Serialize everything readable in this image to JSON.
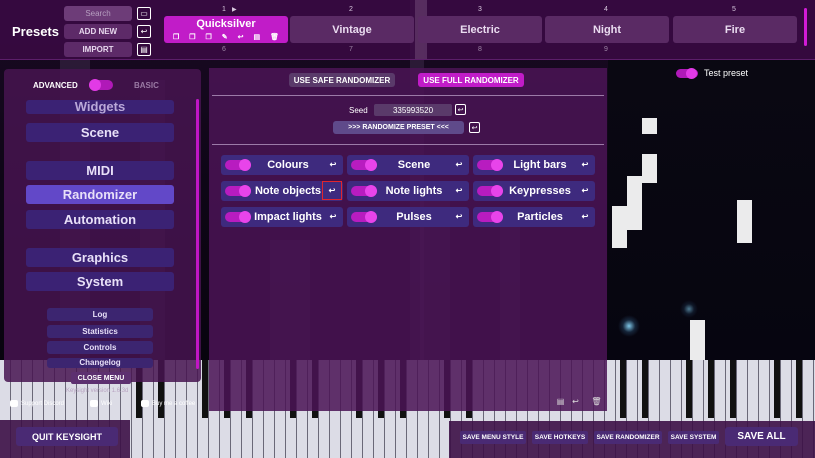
{
  "colors": {
    "accent": "#c11cc8",
    "panel": "#4b1455",
    "button": "#3e2a7e",
    "active_nav": "#6248c8",
    "highlight_outline": "#e0252e"
  },
  "presets": {
    "title": "Presets",
    "search_placeholder": "Search",
    "add_new": "ADD NEW",
    "import": "IMPORT",
    "slots": [
      {
        "number": "1",
        "name": "Quicksilver",
        "active": true
      },
      {
        "number": "2",
        "name": "Vintage",
        "active": false
      },
      {
        "number": "3",
        "name": "Electric",
        "active": false
      },
      {
        "number": "4",
        "name": "Night",
        "active": false
      },
      {
        "number": "5",
        "name": "Fire",
        "active": false
      }
    ],
    "next_row_numbers": [
      "6",
      "7",
      "8",
      "9"
    ]
  },
  "sidebar": {
    "mode_advanced": "ADVANCED",
    "mode_basic": "BASIC",
    "nav": [
      {
        "label": "Widgets"
      },
      {
        "label": "Scene"
      },
      {
        "label": "MIDI"
      },
      {
        "label": "Randomizer",
        "active": true
      },
      {
        "label": "Automation"
      },
      {
        "label": "Graphics"
      },
      {
        "label": "System"
      }
    ],
    "sub": [
      "Log",
      "Statistics",
      "Controls",
      "Changelog"
    ],
    "close_menu": "CLOSE MENU",
    "version": "Keysight version 1.6.3d",
    "support": "Support Discord",
    "wiki": "Wiki",
    "coffee": "Buy me a coffee"
  },
  "randomizer": {
    "safe_label": "USE SAFE RANDOMIZER",
    "full_label": "USE FULL RANDOMIZER",
    "seed_label": "Seed",
    "seed_value": "335993520",
    "randomize_label": ">>> RANDOMIZE PRESET <<<",
    "options": [
      {
        "label": "Colours"
      },
      {
        "label": "Scene"
      },
      {
        "label": "Light bars"
      },
      {
        "label": "Note objects"
      },
      {
        "label": "Note lights"
      },
      {
        "label": "Keypresses"
      },
      {
        "label": "Impact lights"
      },
      {
        "label": "Pulses"
      },
      {
        "label": "Particles"
      }
    ]
  },
  "test_preset": "Test preset",
  "footer": {
    "quit": "QUIT KEYSIGHT",
    "save_menu_style": "SAVE MENU STYLE",
    "save_hotkeys": "SAVE HOTKEYS",
    "save_randomizer": "SAVE RANDOMIZER",
    "save_system": "SAVE SYSTEM",
    "save_all": "SAVE ALL"
  }
}
